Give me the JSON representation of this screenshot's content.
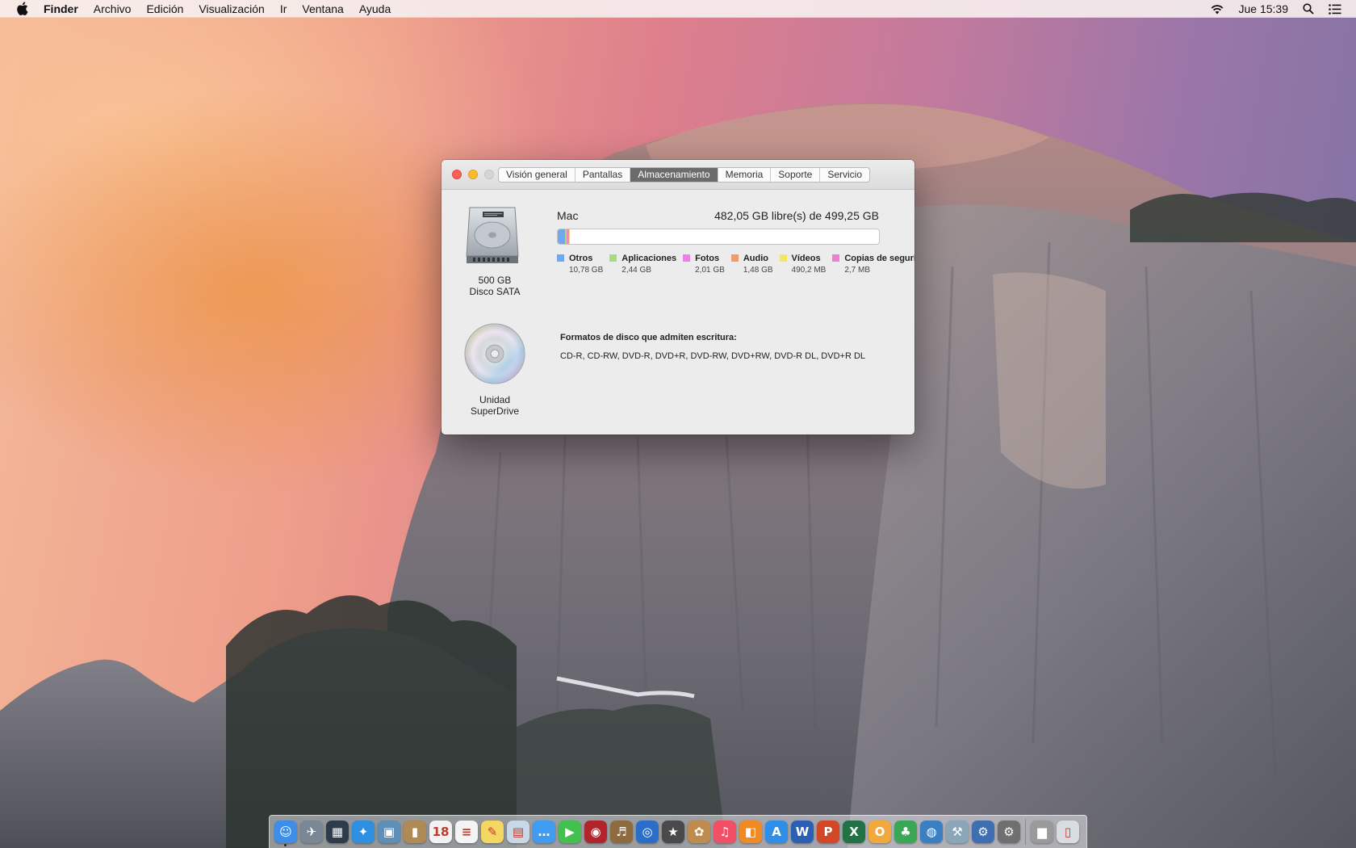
{
  "menubar": {
    "app_name": "Finder",
    "items": [
      "Archivo",
      "Edición",
      "Visualización",
      "Ir",
      "Ventana",
      "Ayuda"
    ],
    "clock": "Jue 15:39",
    "status_icons": [
      "wifi-icon",
      "spotlight-icon",
      "notification-center-icon"
    ]
  },
  "window": {
    "tabs": [
      {
        "label": "Visión general",
        "active": false
      },
      {
        "label": "Pantallas",
        "active": false
      },
      {
        "label": "Almacenamiento",
        "active": true
      },
      {
        "label": "Memoria",
        "active": false
      },
      {
        "label": "Soporte",
        "active": false
      },
      {
        "label": "Servicio",
        "active": false
      }
    ],
    "disk": {
      "capacity": "500 GB",
      "type": "Disco SATA",
      "volume_name": "Mac",
      "free_summary": "482,05 GB libre(s) de 499,25 GB",
      "used_fraction": 0.035,
      "categories": [
        {
          "name": "Otros",
          "size": "10,78 GB",
          "color": "#6fa8f0"
        },
        {
          "name": "Aplicaciones",
          "size": "2,44 GB",
          "color": "#a6de7c"
        },
        {
          "name": "Fotos",
          "size": "2,01 GB",
          "color": "#ef7fe8"
        },
        {
          "name": "Audio",
          "size": "1,48 GB",
          "color": "#f39a6d"
        },
        {
          "name": "Vídeos",
          "size": "490,2 MB",
          "color": "#f6e36a"
        },
        {
          "name": "Copias de seguridad",
          "size": "2,7 MB",
          "color": "#ee7fd6"
        }
      ]
    },
    "optical": {
      "name": "Unidad SuperDrive",
      "formats_title": "Formatos de disco que admiten escritura:",
      "formats": "CD-R, CD-RW, DVD-R, DVD+R, DVD-RW, DVD+RW, DVD-R DL, DVD+R DL"
    }
  },
  "dock": {
    "items": [
      {
        "name": "finder-icon",
        "glyph": "☺",
        "color": "#3d8ee8"
      },
      {
        "name": "launchpad-icon",
        "glyph": "✈",
        "color": "#7a8794"
      },
      {
        "name": "mission-control-icon",
        "glyph": "▦",
        "color": "#2e3b4a"
      },
      {
        "name": "safari-icon",
        "glyph": "✦",
        "color": "#2f8fe0"
      },
      {
        "name": "preview-icon",
        "glyph": "▣",
        "color": "#5f8fb8"
      },
      {
        "name": "contacts-icon",
        "glyph": "▮",
        "color": "#b08a55"
      },
      {
        "name": "calendar-icon",
        "glyph": "18",
        "color": "#f2f2f2"
      },
      {
        "name": "reminders-icon",
        "glyph": "≡",
        "color": "#f4f4f4"
      },
      {
        "name": "notes-icon",
        "glyph": "✎",
        "color": "#f4d763"
      },
      {
        "name": "photo-browser-icon",
        "glyph": "▤",
        "color": "#c9d8e6"
      },
      {
        "name": "messages-icon",
        "glyph": "…",
        "color": "#3f9cf0"
      },
      {
        "name": "facetime-icon",
        "glyph": "▶",
        "color": "#43c14e"
      },
      {
        "name": "photo-booth-icon",
        "glyph": "◉",
        "color": "#b2242c"
      },
      {
        "name": "garageband-icon",
        "glyph": "♬",
        "color": "#8d6b3f"
      },
      {
        "name": "dvd-player-icon",
        "glyph": "◎",
        "color": "#2b6ec9"
      },
      {
        "name": "imovie-icon",
        "glyph": "★",
        "color": "#4a4a4a"
      },
      {
        "name": "iphoto-icon",
        "glyph": "✿",
        "color": "#c08b4f"
      },
      {
        "name": "itunes-icon",
        "glyph": "♫",
        "color": "#f24f66"
      },
      {
        "name": "ibooks-icon",
        "glyph": "◧",
        "color": "#f08a25"
      },
      {
        "name": "app-store-icon",
        "glyph": "A",
        "color": "#2f8fe8"
      },
      {
        "name": "word-icon",
        "glyph": "W",
        "color": "#2b5fb4"
      },
      {
        "name": "powerpoint-icon",
        "glyph": "P",
        "color": "#d24726"
      },
      {
        "name": "excel-icon",
        "glyph": "X",
        "color": "#217346"
      },
      {
        "name": "outlook-icon",
        "glyph": "O",
        "color": "#f0a93a"
      },
      {
        "name": "messenger-icon",
        "glyph": "♣",
        "color": "#3aa757"
      },
      {
        "name": "network-globe-icon",
        "glyph": "◍",
        "color": "#3a7fc2"
      },
      {
        "name": "utility-icon",
        "glyph": "⚒",
        "color": "#8ba5b9"
      },
      {
        "name": "xcode-icon",
        "glyph": "⚙",
        "color": "#3e6fb0"
      },
      {
        "name": "system-preferences-icon",
        "glyph": "⚙",
        "color": "#6f6f6f"
      }
    ],
    "trailing_items": [
      {
        "name": "downloads-stack-icon",
        "glyph": "▆",
        "color": "#9a9a9a"
      },
      {
        "name": "trash-icon",
        "glyph": "▯",
        "color": "#d8dde2"
      }
    ]
  }
}
